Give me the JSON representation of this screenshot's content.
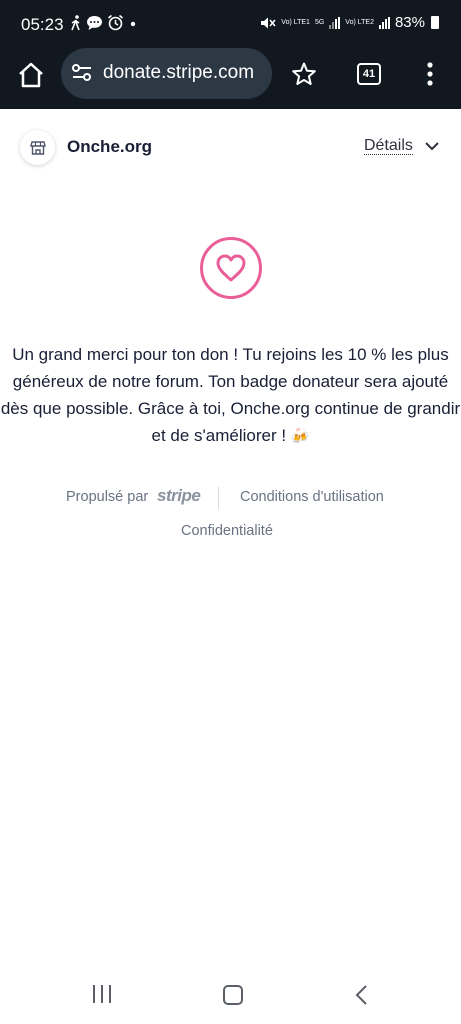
{
  "status_bar": {
    "time": "05:23",
    "network_labels": [
      "Vo) LTE1",
      "5G",
      "Vo) LTE2"
    ],
    "battery": "83%"
  },
  "browser": {
    "url": "donate.stripe.com",
    "tab_count": "41"
  },
  "merchant": {
    "name": "Onche.org",
    "details_label": "Détails"
  },
  "main": {
    "thank_you_line1": "Un grand merci pour ton don ! Tu rejoins les 10 % les plus",
    "thank_you_line2": "généreux de notre forum. Ton badge donateur sera ajouté",
    "thank_you_line3": "dès que possible. Grâce à toi, Onche.org continue de grandir",
    "thank_you_line4": "et de s'améliorer !",
    "emoji": "🍻",
    "heart_color": "#ea5f99"
  },
  "footer": {
    "powered_by": "Propulsé par",
    "stripe_logo": "stripe",
    "terms": "Conditions d'utilisation",
    "privacy": "Confidentialité"
  }
}
